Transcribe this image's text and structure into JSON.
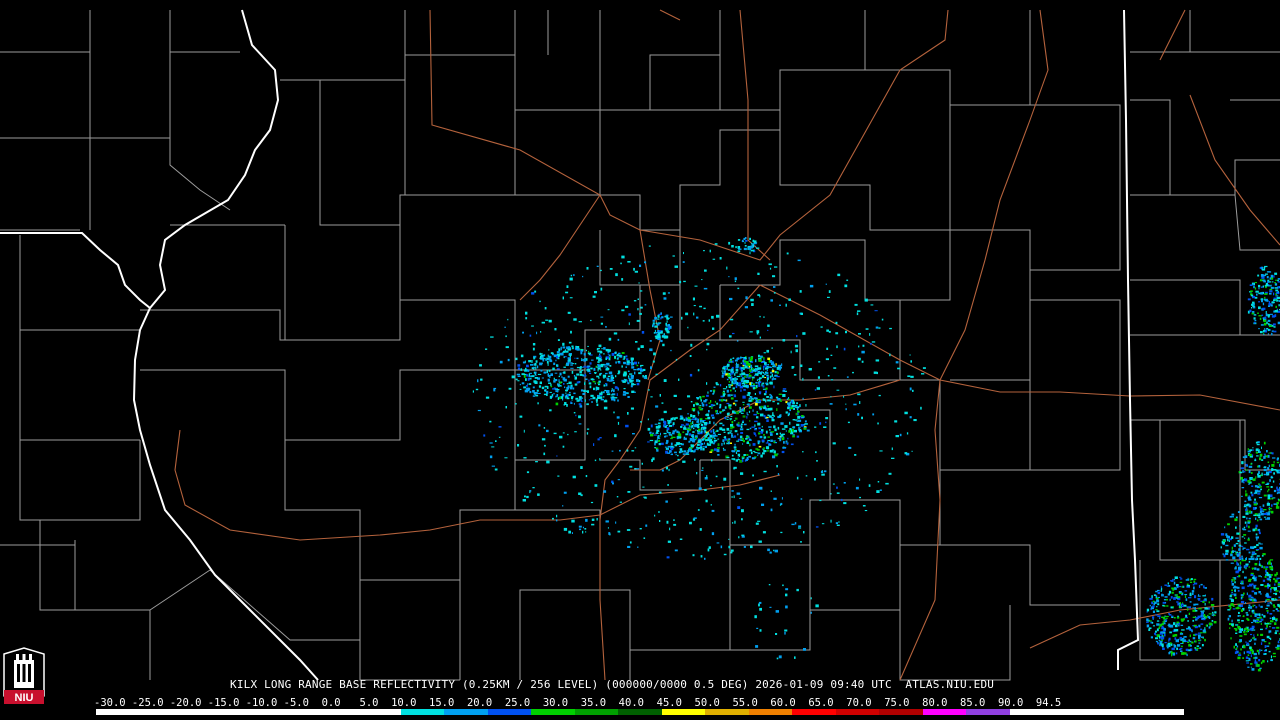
{
  "title": "KILX LONG RANGE BASE REFLECTIVITY (0.25KM / 256 LEVEL) (000000/0000 0.5 DEG) 2026-01-09 09:40 UTC  ATLAS.NIU.EDU",
  "logo_text": "NIU",
  "scale_labels": "-30.0 -25.0 -20.0 -15.0 -10.0 -5.0  0.0   5.0  10.0  15.0  20.0  25.0  30.0  35.0  40.0  45.0  50.0  55.0  60.0  65.0  70.0  75.0  80.0  85.0  90.0  94.5",
  "scale_colors": [
    "#ffffff",
    "#ffffff",
    "#ffffff",
    "#ffffff",
    "#ffffff",
    "#ffffff",
    "#ffffff",
    "#00e0e0",
    "#00a0f0",
    "#0050f0",
    "#00d000",
    "#00a000",
    "#006000",
    "#ffff00",
    "#e0b000",
    "#f08000",
    "#ff0000",
    "#d00000",
    "#b00000",
    "#ff00ff",
    "#9040e0",
    "#ffffff",
    "#ffffff",
    "#ffffff",
    "#ffffff"
  ],
  "colors": {
    "background": "#000000",
    "county_lines": "#c8c8c8",
    "state_lines": "#ffffff",
    "roads": "#b8603a"
  }
}
